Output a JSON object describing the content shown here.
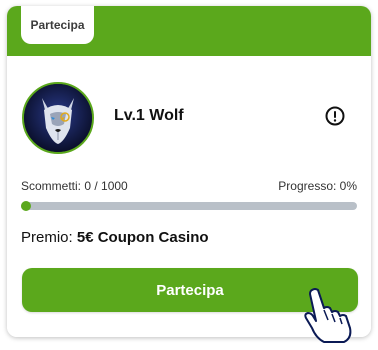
{
  "header": {
    "tab_label": "Partecipa"
  },
  "level": {
    "name": "Lv.1 Wolf",
    "avatar_icon": "wolf-avatar-icon",
    "info_icon": "exclamation-circle-icon"
  },
  "stats": {
    "bets_text": "Scommetti: 0 / 1000",
    "progress_text": "Progresso: 0%",
    "progress_value": 0
  },
  "prize": {
    "label": "Premio:",
    "value": "5€ Coupon Casino"
  },
  "actions": {
    "join_label": "Partecipa"
  },
  "colors": {
    "accent": "#5ba81c",
    "track": "#b9c0c8",
    "cursor_fill": "#ffffff",
    "cursor_stroke": "#0b1a55"
  }
}
